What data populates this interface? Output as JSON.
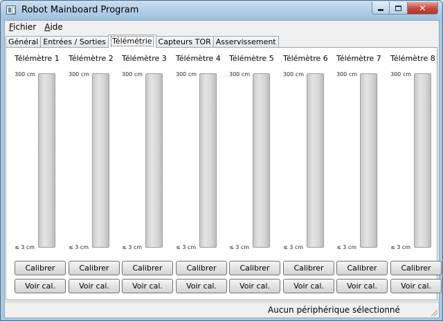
{
  "window": {
    "title": "Robot Mainboard Program",
    "buttons": {
      "close": "✕"
    }
  },
  "menu": [
    {
      "mnemonic": "F",
      "rest": "ichier"
    },
    {
      "mnemonic": "A",
      "rest": "ide"
    }
  ],
  "tabs": [
    {
      "label": "Général"
    },
    {
      "label": "Entrées / Sorties"
    },
    {
      "label": "Télémétrie",
      "active": true
    },
    {
      "label": "Capteurs TOR"
    },
    {
      "label": "Asservissement"
    }
  ],
  "telemetry": {
    "sensors": [
      {
        "title": "Télémètre 1",
        "top_label": "300 cm",
        "bottom_label": "≤ 3 cm",
        "calibrate_label": "Calibrer",
        "view_label": "Voir cal.",
        "level": 0
      },
      {
        "title": "Télémètre 2",
        "top_label": "300 cm",
        "bottom_label": "≤ 3 cm",
        "calibrate_label": "Calibrer",
        "view_label": "Voir cal.",
        "level": 0
      },
      {
        "title": "Télémètre 3",
        "top_label": "300 cm",
        "bottom_label": "≤ 3 cm",
        "calibrate_label": "Calibrer",
        "view_label": "Voir cal.",
        "level": 0
      },
      {
        "title": "Télémètre 4",
        "top_label": "300 cm",
        "bottom_label": "≤ 3 cm",
        "calibrate_label": "Calibrer",
        "view_label": "Voir cal.",
        "level": 0
      },
      {
        "title": "Télémètre 5",
        "top_label": "300 cm",
        "bottom_label": "≤ 3 cm",
        "calibrate_label": "Calibrer",
        "view_label": "Voir cal.",
        "level": 0
      },
      {
        "title": "Télémètre 6",
        "top_label": "300 cm",
        "bottom_label": "≤ 3 cm",
        "calibrate_label": "Calibrer",
        "view_label": "Voir cal.",
        "level": 0
      },
      {
        "title": "Télémètre 7",
        "top_label": "300 cm",
        "bottom_label": "≤ 3 cm",
        "calibrate_label": "Calibrer",
        "view_label": "Voir cal.",
        "level": 0
      },
      {
        "title": "Télémètre 8",
        "top_label": "300 cm",
        "bottom_label": "≤ 3 cm",
        "calibrate_label": "Calibrer",
        "view_label": "Voir cal.",
        "level": 0
      }
    ]
  },
  "status": {
    "text": "Aucun périphérique sélectionné"
  }
}
